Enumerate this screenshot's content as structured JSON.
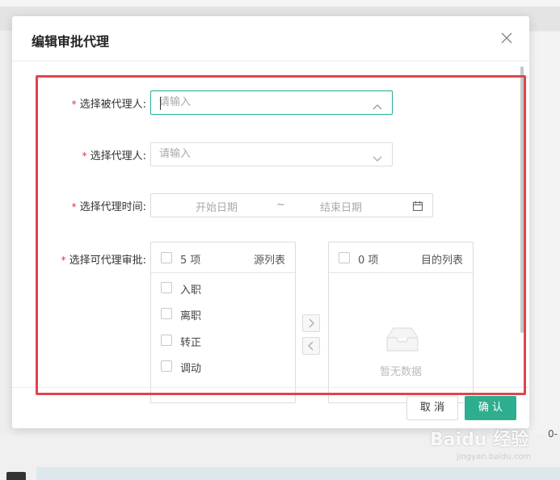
{
  "dialog": {
    "title": "编辑审批代理",
    "close_icon": "close-icon"
  },
  "form": {
    "principal": {
      "label": "选择被代理人:",
      "required_mark": "*",
      "placeholder": "请输入",
      "caret_icon": "chevron-up-icon",
      "focused": true
    },
    "agent": {
      "label": "选择代理人:",
      "required_mark": "*",
      "placeholder": "请输入",
      "caret_icon": "chevron-down-icon"
    },
    "period": {
      "label": "选择代理时间:",
      "required_mark": "*",
      "start_placeholder": "开始日期",
      "separator": "~",
      "end_placeholder": "结束日期",
      "icon": "calendar-icon"
    },
    "approvals": {
      "label": "选择可代理审批:",
      "required_mark": "*",
      "source": {
        "count": "5 项",
        "title": "源列表",
        "items": [
          "入职",
          "离职",
          "转正",
          "调动"
        ]
      },
      "target": {
        "count": "0 项",
        "title": "目的列表",
        "empty_text": "暂无数据",
        "empty_icon": "empty-inbox-icon"
      },
      "move_right_icon": "chevron-right-icon",
      "move_left_icon": "chevron-left-icon"
    }
  },
  "footer": {
    "cancel_label": "取 消",
    "confirm_label": "确 认"
  },
  "background": {
    "snippet": "0-",
    "watermark": "Baidu 经验",
    "watermark_sub": "jingyan.baidu.com"
  },
  "colors": {
    "primary": "#2fae8f",
    "required": "#e0353b",
    "highlight": "#e0444b"
  }
}
